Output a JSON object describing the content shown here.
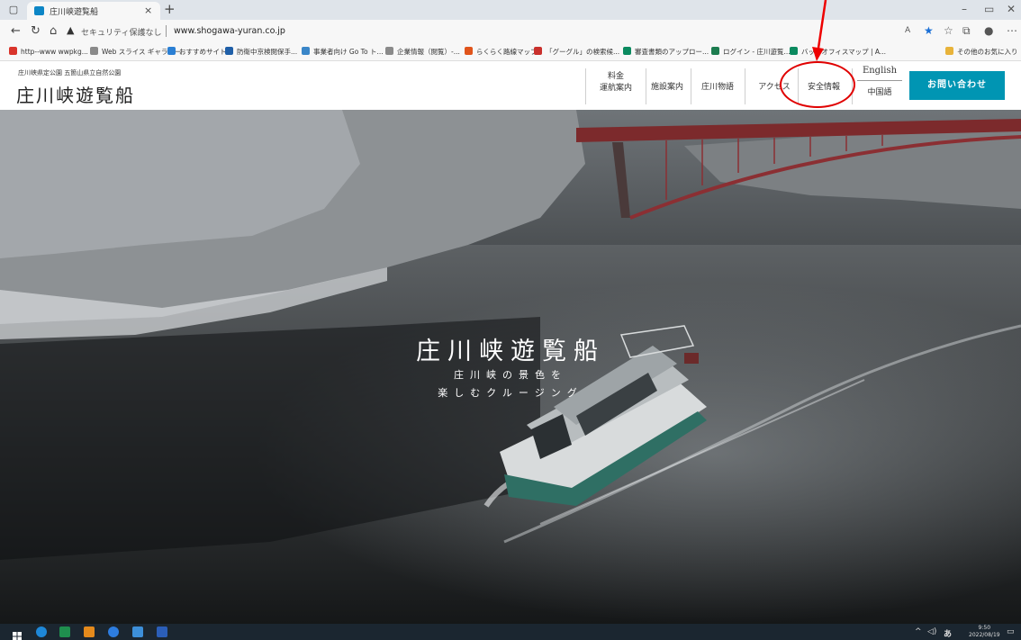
{
  "browser": {
    "tab_title": "庄川峡遊覧船",
    "close_tab": "×",
    "new_tab": "+",
    "security_text": "セキュリティ保護なし",
    "url": "www.shogawa-yuran.co.jp",
    "bookmarks": [
      {
        "label": "http--www wwpkg...",
        "color": "#d9342b"
      },
      {
        "label": "Web スライス ギャラリー",
        "color": "#8a8a8a"
      },
      {
        "label": "おすすめサイト",
        "color": "#2a7fd4"
      },
      {
        "label": "防衛中京検閲保手...",
        "color": "#1f5fa8"
      },
      {
        "label": "事業者向け Go To ト...",
        "color": "#3a86c8"
      },
      {
        "label": "企業情報（閲覧）-...",
        "color": "#8a8a8a"
      },
      {
        "label": "らくらく路線マップ",
        "color": "#e0541b"
      },
      {
        "label": "「グーグル」の検索候...",
        "color": "#c9302c"
      },
      {
        "label": "審査書類のアップロー...",
        "color": "#0b8a5f"
      },
      {
        "label": "ログイン - 庄川遊覧...",
        "color": "#1c7c4f"
      },
      {
        "label": "バックオフィスマップ | A...",
        "color": "#0b8a5f"
      }
    ],
    "other_favorites": "その他のお気に入り"
  },
  "site": {
    "subtitle": "庄川峡県定公園 五箇山県立自然公園",
    "logo": "庄川峡遊覧船",
    "nav": {
      "fare_line1": "料金",
      "fare_line2": "運航案内",
      "facility": "施設案内",
      "story": "庄川物語",
      "access": "アクセス",
      "safety": "安全情報",
      "english": "English",
      "chinese": "中国語",
      "contact": "お問い合わせ"
    }
  },
  "hero": {
    "title": "庄川峡遊覧船",
    "tagline_line1": "庄川峡の景色を",
    "tagline_line2": "楽しむクルージング"
  },
  "taskbar": {
    "time": "9:50",
    "date": "2022/08/19",
    "ime": "あ"
  },
  "colors": {
    "contact_button": "#0095b3",
    "annotation": "#e00000"
  }
}
